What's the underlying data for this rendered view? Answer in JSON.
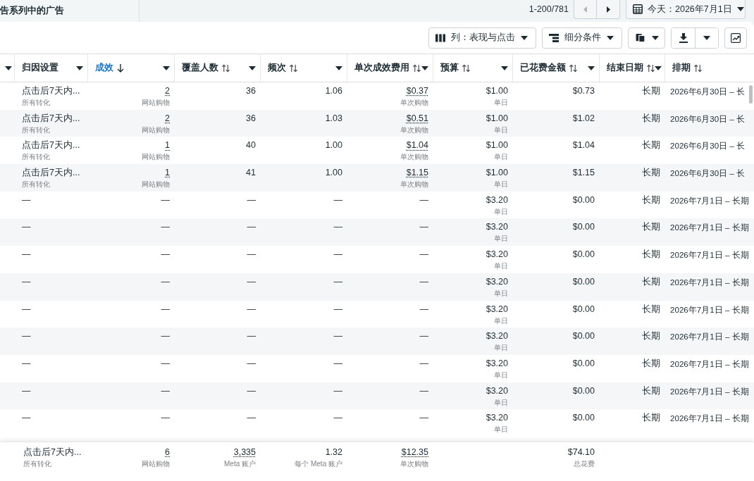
{
  "top_bar": {
    "title": "告系列中的广告",
    "pagination": {
      "range": "1-200/781",
      "buttons": [
        {
          "kind": "previous",
          "disabled": true
        },
        {
          "kind": "next",
          "disabled": false
        }
      ]
    },
    "date_button": {
      "label": "今天：2026年7月1日"
    }
  },
  "toolbar": {
    "buttons": [
      {
        "label": "列：表现与点击"
      },
      {
        "label": "细分条件"
      }
    ]
  },
  "table": {
    "columns": [
      {
        "label": "归因设置",
        "kind": "setting",
        "sortable": false,
        "sorted": false,
        "dropdown": true
      },
      {
        "label": "成效",
        "kind": "metric",
        "sortable": true,
        "sorted": true,
        "dropdown": true
      },
      {
        "label": "覆盖人数",
        "kind": "metric",
        "sortable": true,
        "sorted": false,
        "dropdown": true
      },
      {
        "label": "频次",
        "kind": "metric",
        "sortable": true,
        "sorted": false,
        "dropdown": true
      },
      {
        "label": "单次成效费用",
        "kind": "metric",
        "sortable": true,
        "sorted": false,
        "dropdown": true
      },
      {
        "label": "预算",
        "kind": "metric",
        "sortable": true,
        "sorted": false,
        "dropdown": true
      },
      {
        "label": "已花费金额",
        "kind": "metric",
        "sortable": true,
        "sorted": false,
        "dropdown": true
      },
      {
        "label": "结束日期",
        "kind": "end_date",
        "sortable": true,
        "sorted": false,
        "dropdown": true
      },
      {
        "label": "排期",
        "kind": "schedule",
        "sortable": true,
        "sorted": false,
        "dropdown": false
      }
    ],
    "rows": [
      {
        "cells": [
          {
            "text": "点击后7天内...",
            "note": "所有转化",
            "dotted": false
          },
          {
            "text": "2",
            "note": "网站购物",
            "dotted": true
          },
          {
            "text": "36",
            "dotted": false
          },
          {
            "text": "1.06",
            "dotted": false
          },
          {
            "text": "$0.37",
            "note": "单次购物",
            "dotted": true
          },
          {
            "text": "$1.00",
            "note": "单日",
            "dotted": false
          },
          {
            "text": "$0.73",
            "dotted": false
          },
          {
            "text": "长期",
            "dotted": false
          },
          {
            "text": "2026年6月30日 – 长",
            "dotted": false
          }
        ]
      },
      {
        "cells": [
          {
            "text": "点击后7天内...",
            "note": "所有转化",
            "dotted": false
          },
          {
            "text": "2",
            "note": "网站购物",
            "dotted": true
          },
          {
            "text": "36",
            "dotted": false
          },
          {
            "text": "1.03",
            "dotted": false
          },
          {
            "text": "$0.51",
            "note": "单次购物",
            "dotted": true
          },
          {
            "text": "$1.00",
            "note": "单日",
            "dotted": false
          },
          {
            "text": "$1.02",
            "dotted": false
          },
          {
            "text": "长期",
            "dotted": false
          },
          {
            "text": "2026年6月30日 – 长",
            "dotted": false
          }
        ]
      },
      {
        "cells": [
          {
            "text": "点击后7天内...",
            "note": "所有转化",
            "dotted": false
          },
          {
            "text": "1",
            "note": "网站购物",
            "dotted": true
          },
          {
            "text": "40",
            "dotted": false
          },
          {
            "text": "1.00",
            "dotted": false
          },
          {
            "text": "$1.04",
            "note": "单次购物",
            "dotted": true
          },
          {
            "text": "$1.00",
            "note": "单日",
            "dotted": false
          },
          {
            "text": "$1.04",
            "dotted": false
          },
          {
            "text": "长期",
            "dotted": false
          },
          {
            "text": "2026年6月30日 – 长",
            "dotted": false
          }
        ]
      },
      {
        "cells": [
          {
            "text": "点击后7天内...",
            "note": "所有转化",
            "dotted": false
          },
          {
            "text": "1",
            "note": "网站购物",
            "dotted": true
          },
          {
            "text": "41",
            "dotted": false
          },
          {
            "text": "1.00",
            "dotted": false
          },
          {
            "text": "$1.15",
            "note": "单次购物",
            "dotted": true
          },
          {
            "text": "$1.00",
            "note": "单日",
            "dotted": false
          },
          {
            "text": "$1.15",
            "dotted": false
          },
          {
            "text": "长期",
            "dotted": false
          },
          {
            "text": "2026年6月30日 – 长",
            "dotted": false
          }
        ]
      },
      {
        "cells": [
          {
            "text": "—",
            "dotted": false
          },
          {
            "text": "—",
            "dotted": false
          },
          {
            "text": "—",
            "dotted": false
          },
          {
            "text": "—",
            "dotted": false
          },
          {
            "text": "—",
            "dotted": false
          },
          {
            "text": "$3.20",
            "note": "单日",
            "dotted": false
          },
          {
            "text": "$0.00",
            "dotted": false
          },
          {
            "text": "长期",
            "dotted": false
          },
          {
            "text": "2026年7月1日 – 长期",
            "dotted": false
          }
        ]
      },
      {
        "cells": [
          {
            "text": "—",
            "dotted": false
          },
          {
            "text": "—",
            "dotted": false
          },
          {
            "text": "—",
            "dotted": false
          },
          {
            "text": "—",
            "dotted": false
          },
          {
            "text": "—",
            "dotted": false
          },
          {
            "text": "$3.20",
            "note": "单日",
            "dotted": false
          },
          {
            "text": "$0.00",
            "dotted": false
          },
          {
            "text": "长期",
            "dotted": false
          },
          {
            "text": "2026年7月1日 – 长期",
            "dotted": false
          }
        ]
      },
      {
        "cells": [
          {
            "text": "—",
            "dotted": false
          },
          {
            "text": "—",
            "dotted": false
          },
          {
            "text": "—",
            "dotted": false
          },
          {
            "text": "—",
            "dotted": false
          },
          {
            "text": "—",
            "dotted": false
          },
          {
            "text": "$3.20",
            "note": "单日",
            "dotted": false
          },
          {
            "text": "$0.00",
            "dotted": false
          },
          {
            "text": "长期",
            "dotted": false
          },
          {
            "text": "2026年7月1日 – 长期",
            "dotted": false
          }
        ]
      },
      {
        "cells": [
          {
            "text": "—",
            "dotted": false
          },
          {
            "text": "—",
            "dotted": false
          },
          {
            "text": "—",
            "dotted": false
          },
          {
            "text": "—",
            "dotted": false
          },
          {
            "text": "—",
            "dotted": false
          },
          {
            "text": "$3.20",
            "note": "单日",
            "dotted": false
          },
          {
            "text": "$0.00",
            "dotted": false
          },
          {
            "text": "长期",
            "dotted": false
          },
          {
            "text": "2026年7月1日 – 长期",
            "dotted": false
          }
        ]
      },
      {
        "cells": [
          {
            "text": "—",
            "dotted": false
          },
          {
            "text": "—",
            "dotted": false
          },
          {
            "text": "—",
            "dotted": false
          },
          {
            "text": "—",
            "dotted": false
          },
          {
            "text": "—",
            "dotted": false
          },
          {
            "text": "$3.20",
            "note": "单日",
            "dotted": false
          },
          {
            "text": "$0.00",
            "dotted": false
          },
          {
            "text": "长期",
            "dotted": false
          },
          {
            "text": "2026年7月1日 – 长期",
            "dotted": false
          }
        ]
      },
      {
        "cells": [
          {
            "text": "—",
            "dotted": false
          },
          {
            "text": "—",
            "dotted": false
          },
          {
            "text": "—",
            "dotted": false
          },
          {
            "text": "—",
            "dotted": false
          },
          {
            "text": "—",
            "dotted": false
          },
          {
            "text": "$3.20",
            "note": "单日",
            "dotted": false
          },
          {
            "text": "$0.00",
            "dotted": false
          },
          {
            "text": "长期",
            "dotted": false
          },
          {
            "text": "2026年7月1日 – 长期",
            "dotted": false
          }
        ]
      },
      {
        "cells": [
          {
            "text": "—",
            "dotted": false
          },
          {
            "text": "—",
            "dotted": false
          },
          {
            "text": "—",
            "dotted": false
          },
          {
            "text": "—",
            "dotted": false
          },
          {
            "text": "—",
            "dotted": false
          },
          {
            "text": "$3.20",
            "note": "单日",
            "dotted": false
          },
          {
            "text": "$0.00",
            "dotted": false
          },
          {
            "text": "长期",
            "dotted": false
          },
          {
            "text": "2026年7月1日 – 长期",
            "dotted": false
          }
        ]
      },
      {
        "cells": [
          {
            "text": "—",
            "dotted": false
          },
          {
            "text": "—",
            "dotted": false
          },
          {
            "text": "—",
            "dotted": false
          },
          {
            "text": "—",
            "dotted": false
          },
          {
            "text": "—",
            "dotted": false
          },
          {
            "text": "$3.20",
            "note": "单日",
            "dotted": false
          },
          {
            "text": "$0.00",
            "dotted": false
          },
          {
            "text": "长期",
            "dotted": false
          },
          {
            "text": "2026年7月1日 – 长期",
            "dotted": false
          }
        ]
      },
      {
        "cells": [
          {
            "text": "—",
            "dotted": false
          },
          {
            "text": "—",
            "dotted": false
          },
          {
            "text": "—",
            "dotted": false
          },
          {
            "text": "—",
            "dotted": false
          },
          {
            "text": "—",
            "dotted": false
          },
          {
            "text": "$3.20",
            "note": "单日",
            "dotted": false
          },
          {
            "text": "$0.00",
            "dotted": false
          },
          {
            "text": "长期",
            "dotted": false
          },
          {
            "text": "2026年7月1日 – 长期",
            "dotted": false
          }
        ]
      }
    ],
    "summary": {
      "attribution_setting": {
        "text": "点击后7天内...",
        "note": "所有转化",
        "dotted": false
      },
      "results": {
        "text": "6",
        "note": "网站购物",
        "dotted": true
      },
      "reach": {
        "text": "3,335",
        "note": "Meta 账户",
        "dotted": true
      },
      "frequency": {
        "text": "1.32",
        "note": "每个 Meta 账户",
        "dotted": false
      },
      "cost_per_result": {
        "text": "$12.35",
        "note": "单次购物",
        "dotted": true
      },
      "amount_spent": {
        "text": "$74.10",
        "note": "总花费",
        "dotted": false
      }
    }
  }
}
